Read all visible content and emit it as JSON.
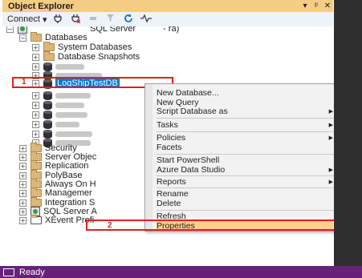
{
  "panel": {
    "title": "Object Explorer",
    "title_buttons": [
      "▾",
      "ᵖ",
      "✕"
    ]
  },
  "toolbar": {
    "connect_label": "Connect",
    "connect_arrow": "▾"
  },
  "tree": {
    "server_label": "SQL Server",
    "server_suffix": "- ra)",
    "databases_label": "Databases",
    "system_databases_label": "System Databases",
    "database_snapshots_label": "Database Snapshots",
    "selected_db_part1": "LogShip",
    "selected_db_part2": "TestDB",
    "security_label": "Security",
    "server_objects_label": "Server Objec",
    "replication_label": "Replication",
    "polybase_label": "PolyBase",
    "always_on_label": "Always On H",
    "management_label": "Managemer",
    "integration_label": "Integration S",
    "sql_agent_label": "SQL Server A",
    "xevent_label": "XEvent Profi"
  },
  "annotations": {
    "step1": "1",
    "step2": "2"
  },
  "context_menu": {
    "new_database": "New Database...",
    "new_query": "New Query",
    "script_database": "Script Database as",
    "tasks": "Tasks",
    "policies": "Policies",
    "facets": "Facets",
    "start_powershell": "Start PowerShell",
    "azure_data_studio": "Azure Data Studio",
    "reports": "Reports",
    "rename": "Rename",
    "delete": "Delete",
    "refresh": "Refresh",
    "properties": "Properties",
    "submenu_arrow": "▶"
  },
  "status_bar": {
    "text": "Ready"
  },
  "colors": {
    "title_bar": "#f5cc84",
    "selection": "#0078d7",
    "highlight": "#fbd18d",
    "callout_red": "#e02020",
    "status_bar": "#68217a"
  }
}
